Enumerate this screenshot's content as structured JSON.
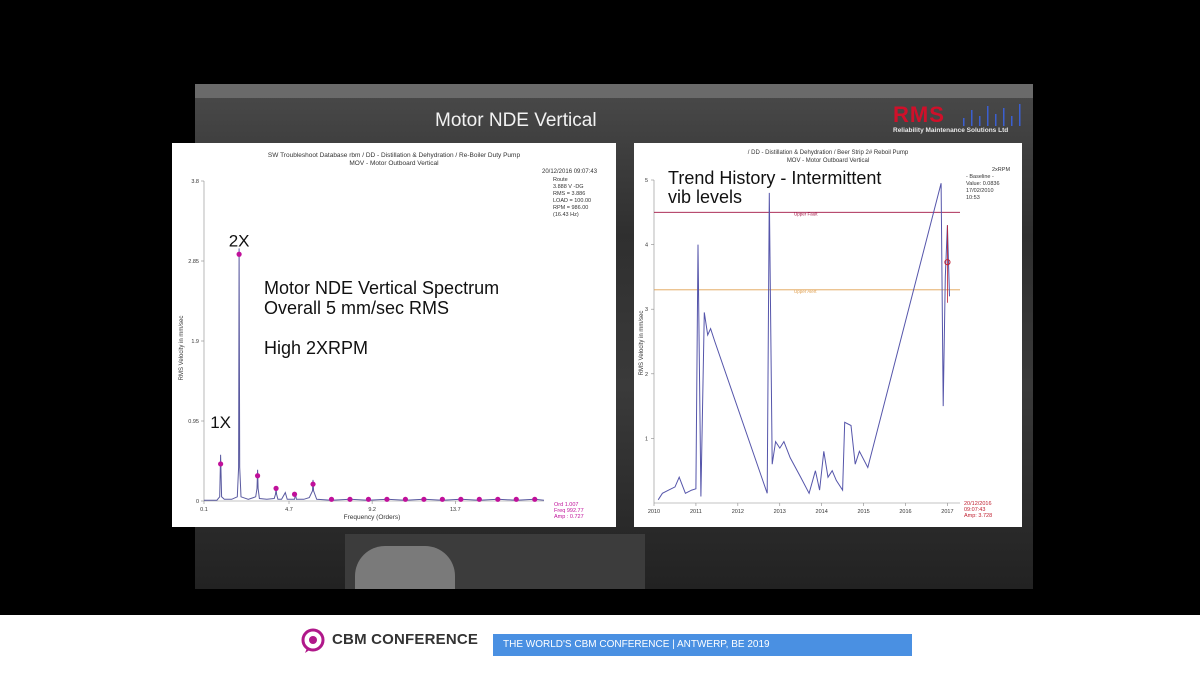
{
  "slide": {
    "title": "Motor NDE Vertical",
    "logo_text": "RMS",
    "logo_subtext": "Reliability Maintenance Solutions Ltd"
  },
  "footer": {
    "brand": "CBM CONFERENCE",
    "tagline": "THE  WORLD'S CBM CONFERENCE  |  ANTWERP, BE 2019"
  },
  "colors": {
    "spectrum_line": "#5a5aa0",
    "marker": "#c0109a",
    "trend_line": "#5555aa",
    "upper_fault": "#a01040",
    "upper_alert": "#e0a050",
    "footer_bar": "#4a90e2",
    "logo_red": "#d0102a"
  },
  "chart_data": [
    {
      "type": "line",
      "header": "SW Troubleshoot Database rbm / DD - Distillation & Dehydration / Re-Boiler Duty Pump",
      "subheader": "MOV - Motor Outboard Vertical",
      "info": [
        "20/12/2016 09:07:43",
        "Route",
        "3.888 V -DG",
        "RMS = 3.886",
        "LOAD = 100.00",
        "RPM = 986.00",
        "(16.43 Hz)"
      ],
      "annotations": [
        "Motor NDE Vertical Spectrum",
        "Overall 5 mm/sec RMS",
        "High 2XRPM"
      ],
      "peak_labels": [
        {
          "text": "1X",
          "x": 1
        },
        {
          "text": "2X",
          "x": 2
        }
      ],
      "xlabel": "Frequency (Orders)",
      "ylabel": "RMS Velocity in mm/sec",
      "x_ticks": [
        "0.1",
        "4.7",
        "9.2",
        "13.7"
      ],
      "x_tick_values": [
        0.1,
        4.7,
        9.2,
        13.7
      ],
      "y_ticks": [
        "3.8",
        "2.85",
        "1.9",
        "0.95",
        "0"
      ],
      "y_tick_values": [
        3.8,
        2.85,
        1.9,
        0.95,
        0
      ],
      "xlim": [
        0.1,
        18.5
      ],
      "ylim": [
        0,
        3.8
      ],
      "series": [
        {
          "x": [
            0.1,
            0.8,
            0.95,
            1.0,
            1.05,
            1.2,
            1.6,
            1.9,
            1.97,
            2.0,
            2.03,
            2.1,
            2.5,
            2.9,
            2.97,
            3.0,
            3.03,
            3.1,
            3.5,
            3.9,
            3.97,
            4.0,
            4.03,
            4.1,
            4.3,
            4.5,
            4.6,
            4.8,
            5.0,
            5.05,
            5.1,
            5.2,
            5.5,
            5.8,
            5.97,
            6.0,
            6.03,
            6.2,
            7,
            8,
            9,
            10,
            11,
            12,
            13,
            14,
            15,
            16,
            17,
            18,
            18.5
          ],
          "y": [
            0.01,
            0.01,
            0.05,
            0.55,
            0.05,
            0.02,
            0.02,
            0.05,
            0.4,
            3.0,
            0.4,
            0.05,
            0.02,
            0.05,
            0.15,
            0.37,
            0.15,
            0.03,
            0.02,
            0.03,
            0.08,
            0.15,
            0.08,
            0.02,
            0.02,
            0.1,
            0.02,
            0.02,
            0.02,
            0.08,
            0.02,
            0.02,
            0.02,
            0.04,
            0.12,
            0.25,
            0.12,
            0.02,
            0.01,
            0.02,
            0.01,
            0.02,
            0.01,
            0.02,
            0.01,
            0.02,
            0.01,
            0.02,
            0.01,
            0.02,
            0.01
          ]
        }
      ],
      "markers": {
        "x": [
          1,
          2,
          3,
          4,
          5,
          6,
          7,
          8,
          9,
          10,
          11,
          12,
          13,
          14,
          15,
          16,
          17,
          18
        ],
        "y": [
          0.44,
          2.93,
          0.3,
          0.15,
          0.08,
          0.2,
          0.02,
          0.02,
          0.02,
          0.02,
          0.02,
          0.02,
          0.02,
          0.02,
          0.02,
          0.02,
          0.02,
          0.02
        ]
      },
      "cursor_readout": [
        "Ord 1.007",
        "Freq 992.77",
        "Amp : 0.727"
      ]
    },
    {
      "type": "line",
      "header": "/ DD - Distillation & Dehydration / Beer Strip 2# Reboil Pump",
      "subheader": "MOV - Motor Outboard Vertical",
      "info": [
        "2xRPM",
        "- Baseline -",
        "Value: 0.0836",
        "17/02/2010",
        "10:53"
      ],
      "annotations": [
        "Trend History - Intermittent",
        "vib levels"
      ],
      "ylabel": "RMS Velocity in mm/sec",
      "x_ticks": [
        "2010",
        "2011",
        "2012",
        "2013",
        "2014",
        "2015",
        "2016",
        "2017"
      ],
      "x_tick_values": [
        2010,
        2011,
        2012,
        2013,
        2014,
        2015,
        2016,
        2017
      ],
      "y_ticks": [
        "5",
        "4",
        "3",
        "2",
        "1"
      ],
      "y_tick_values": [
        5,
        4,
        3,
        2,
        1
      ],
      "xlim": [
        2010,
        2017.3
      ],
      "ylim": [
        0,
        5
      ],
      "thresholds": [
        {
          "label": "Upper Fault",
          "value": 4.5
        },
        {
          "label": "Upper Alert",
          "value": 3.3
        }
      ],
      "series": [
        {
          "x": [
            2010.1,
            2010.2,
            2010.35,
            2010.5,
            2010.6,
            2010.75,
            2010.9,
            2011.0,
            2011.05,
            2011.12,
            2011.2,
            2011.28,
            2011.35,
            2011.45,
            2012.7,
            2012.75,
            2012.82,
            2012.9,
            2013.0,
            2013.1,
            2013.25,
            2013.5,
            2013.7,
            2013.85,
            2013.95,
            2014.05,
            2014.15,
            2014.25,
            2014.35,
            2014.5,
            2014.55,
            2014.7,
            2014.8,
            2014.9,
            2015.1,
            2016.85,
            2016.9,
            2016.95,
            2017.0,
            2017.05
          ],
          "y": [
            0.05,
            0.15,
            0.2,
            0.25,
            0.4,
            0.15,
            0.2,
            0.22,
            4.0,
            0.1,
            2.95,
            2.6,
            2.7,
            2.5,
            0.15,
            4.8,
            0.6,
            0.95,
            0.85,
            0.95,
            0.7,
            0.4,
            0.15,
            0.5,
            0.2,
            0.8,
            0.4,
            0.5,
            0.35,
            0.2,
            1.25,
            1.2,
            0.6,
            0.8,
            0.55,
            4.95,
            1.5,
            3.5,
            4.3,
            3.2
          ]
        }
      ],
      "cursor": {
        "x": 2017.0,
        "y": 3.728
      },
      "cursor_readout": [
        "20/12/2016",
        "09:07:43",
        "Amp: 3.728"
      ]
    }
  ]
}
